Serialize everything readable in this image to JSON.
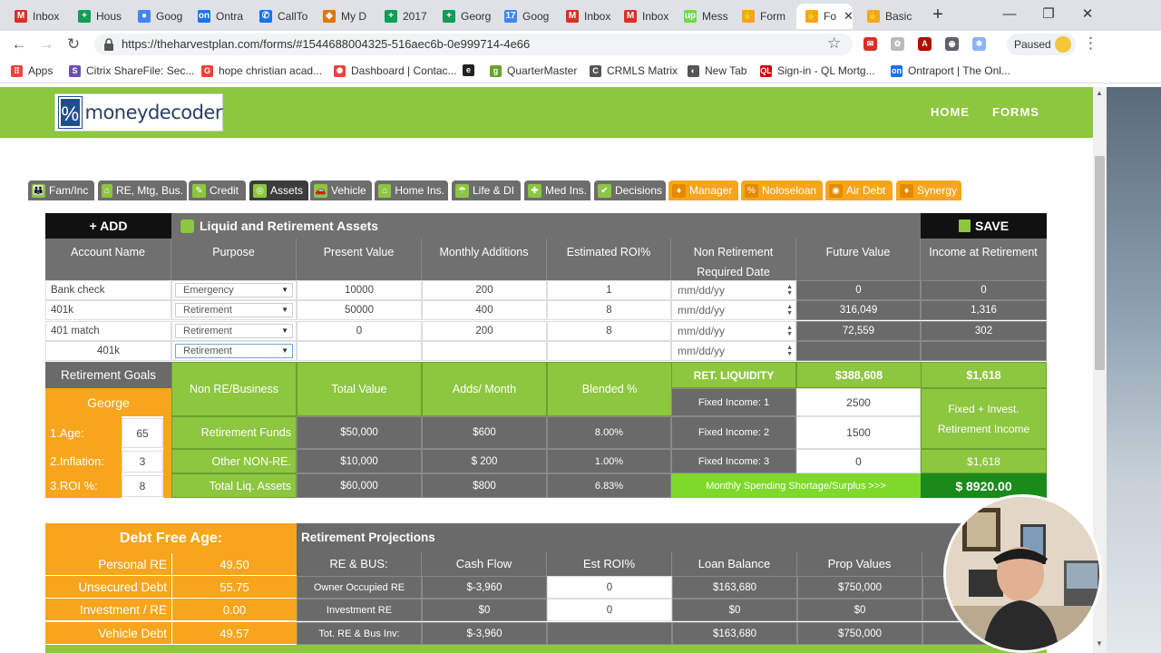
{
  "browser": {
    "tabs": [
      {
        "label": "Inbox",
        "icon": "gmail-icon",
        "color": "#d93025",
        "glyph": "M"
      },
      {
        "label": "Hous",
        "icon": "sheets-icon",
        "color": "#0f9d58",
        "glyph": "+"
      },
      {
        "label": "Goog",
        "icon": "google-icon",
        "color": "#4285f4",
        "glyph": "●"
      },
      {
        "label": "Ontra",
        "icon": "ontraport-icon",
        "color": "#1a73e8",
        "glyph": "on"
      },
      {
        "label": "CallTo",
        "icon": "phone-icon",
        "color": "#1a73e8",
        "glyph": "✆"
      },
      {
        "label": "My D",
        "icon": "drive-icon",
        "color": "#e37400",
        "glyph": "◆"
      },
      {
        "label": "2017",
        "icon": "sheets-icon",
        "color": "#0f9d58",
        "glyph": "+"
      },
      {
        "label": "Georg",
        "icon": "sheets-icon",
        "color": "#0f9d58",
        "glyph": "+"
      },
      {
        "label": "Goog",
        "icon": "calendar-icon",
        "color": "#4285f4",
        "glyph": "17"
      },
      {
        "label": "Inbox",
        "icon": "gmail-icon",
        "color": "#d93025",
        "glyph": "M"
      },
      {
        "label": "Inbox",
        "icon": "gmail-icon",
        "color": "#d93025",
        "glyph": "M"
      },
      {
        "label": "Mess",
        "icon": "upwork-icon",
        "color": "#6fda44",
        "glyph": "up"
      },
      {
        "label": "Form",
        "icon": "harvest-icon",
        "color": "#f7a51c",
        "glyph": "✋"
      },
      {
        "label": "Fo",
        "icon": "harvest-icon",
        "color": "#f7a51c",
        "glyph": "✋"
      },
      {
        "label": "Basic",
        "icon": "harvest-icon",
        "color": "#f7a51c",
        "glyph": "✋"
      }
    ],
    "url": "https://theharvestplan.com/forms/#1544688004325-516aec6b-0e999714-4e66",
    "paused_label": "Paused",
    "bookmarks": [
      {
        "label": "Apps",
        "icon": "apps-icon",
        "color": "#e8453c",
        "glyph": "⠿"
      },
      {
        "label": "Citrix ShareFile: Sec...",
        "icon": "citrix-icon",
        "color": "#6a4fb0",
        "glyph": "S"
      },
      {
        "label": "hope christian acad...",
        "icon": "google-icon",
        "color": "#ea4335",
        "glyph": "G"
      },
      {
        "label": "Dashboard | Contac...",
        "icon": "constant-contact-icon",
        "color": "#e8453c",
        "glyph": "✺"
      },
      {
        "label": "",
        "icon": "ebay-icon",
        "color": "#222",
        "glyph": "e"
      },
      {
        "label": "QuarterMaster",
        "icon": "quartermaster-icon",
        "color": "#6aa12d",
        "glyph": "g"
      },
      {
        "label": "CRMLS Matrix",
        "icon": "crmls-icon",
        "color": "#555",
        "glyph": "C"
      },
      {
        "label": "New Tab",
        "icon": "globe-icon",
        "color": "#555",
        "glyph": "◐"
      },
      {
        "label": "Sign-in - QL Mortg...",
        "icon": "ql-icon",
        "color": "#c00",
        "glyph": "QL"
      },
      {
        "label": "Ontraport | The Onl...",
        "icon": "ontraport-icon",
        "color": "#1a73e8",
        "glyph": "on"
      }
    ]
  },
  "site": {
    "logo_text": "moneydecoder",
    "nav": [
      "HOME",
      "FORMS"
    ]
  },
  "section_tabs": [
    {
      "label": "Fam/Inc",
      "style": "grey",
      "icon": "family-icon"
    },
    {
      "label": "RE, Mtg, Bus.",
      "style": "grey",
      "icon": "house-icon"
    },
    {
      "label": "Credit",
      "style": "grey",
      "icon": "credit-icon"
    },
    {
      "label": "Assets",
      "style": "dark",
      "icon": "assets-icon"
    },
    {
      "label": "Vehicle",
      "style": "grey",
      "icon": "car-icon"
    },
    {
      "label": "Home Ins.",
      "style": "grey",
      "icon": "home-ins-icon"
    },
    {
      "label": "Life & DI",
      "style": "grey",
      "icon": "umbrella-icon"
    },
    {
      "label": "Med Ins.",
      "style": "grey",
      "icon": "medical-icon"
    },
    {
      "label": "Decisions",
      "style": "grey",
      "icon": "decisions-icon"
    },
    {
      "label": "Manager",
      "style": "orange",
      "icon": "manager-icon"
    },
    {
      "label": "Noloseloan",
      "style": "orange",
      "icon": "noloseloan-icon"
    },
    {
      "label": "Air Debt",
      "style": "orange",
      "icon": "airdebt-icon"
    },
    {
      "label": "Synergy",
      "style": "orange",
      "icon": "synergy-icon"
    }
  ],
  "assets": {
    "add_label": "+ ADD",
    "title": "Liquid and Retirement Assets",
    "save_label": "SAVE",
    "columns": [
      "Account Name",
      "Purpose",
      "Present Value",
      "Monthly Additions",
      "Estimated ROI%",
      "Non Retirement Required Date",
      "Future Value",
      "Income at Retirement"
    ],
    "rows": [
      {
        "name": "Bank check",
        "purpose": "Emergency",
        "present": "10000",
        "monthly": "200",
        "roi": "1",
        "date": "mm/dd/yy",
        "future": "0",
        "income": "0"
      },
      {
        "name": "401k",
        "purpose": "Retirement",
        "present": "50000",
        "monthly": "400",
        "roi": "8",
        "date": "mm/dd/yy",
        "future": "316,049",
        "income": "1,316"
      },
      {
        "name": "401 match",
        "purpose": "Retirement",
        "present": "0",
        "monthly": "200",
        "roi": "8",
        "date": "mm/dd/yy",
        "future": "72,559",
        "income": "302"
      },
      {
        "name": "401k",
        "purpose": "Retirement",
        "present": "",
        "monthly": "",
        "roi": "",
        "date": "mm/dd/yy",
        "future": "",
        "income": ""
      }
    ]
  },
  "goals": {
    "title": "Retirement Goals",
    "person": "George",
    "age_label": "1.Age:",
    "age": "65",
    "inflation_label": "2.Inflation:",
    "inflation": "3",
    "roi_label": "3.ROI %:",
    "roi": "8",
    "headers": [
      "Non RE/Business",
      "Total Value",
      "Adds/ Month",
      "Blended %"
    ],
    "rows": [
      {
        "label": "Retirement Funds",
        "total": "$50,000",
        "adds": "$600",
        "blended": "8.00%"
      },
      {
        "label": "Other NON-RE.",
        "total": "$10,000",
        "adds": "$ 200",
        "blended": "1.00%"
      },
      {
        "label": "Total Liq. Assets",
        "total": "$60,000",
        "adds": "$800",
        "blended": "6.83%"
      }
    ],
    "ret_liquidity_label": "RET. LIQUIDITY",
    "ret_liquidity": "$388,608",
    "ret_income_top": "$1,618",
    "fixed": [
      {
        "label": "Fixed Income: 1",
        "value": "2500"
      },
      {
        "label": "Fixed Income: 2",
        "value": "1500"
      },
      {
        "label": "Fixed Income: 3",
        "value": "0"
      }
    ],
    "fixed_invest_label": "Fixed + Invest. Retirement Income",
    "fixed_invest_value": "$1,618",
    "shortage_label": "Monthly Spending Shortage/Surplus >>>",
    "shortage_value": "$ 8920.00"
  },
  "debt": {
    "title": "Debt Free Age:",
    "rows": [
      {
        "label": "Personal RE",
        "value": "49.50"
      },
      {
        "label": "Unsecured Debt",
        "value": "55.75"
      },
      {
        "label": "Investment / RE",
        "value": "0.00"
      },
      {
        "label": "Vehicle Debt",
        "value": "49.57"
      }
    ]
  },
  "projections": {
    "title": "Retirement Projections",
    "headers": [
      "RE & BUS:",
      "Cash Flow",
      "Est ROI%",
      "Loan Balance",
      "Prop Values"
    ],
    "rows": [
      {
        "label": "Owner Occupied RE",
        "cash": "$-3,960",
        "roi": "0",
        "loan": "$163,680",
        "prop": "$750,000"
      },
      {
        "label": "Investment RE",
        "cash": "$0",
        "roi": "0",
        "loan": "$0",
        "prop": "$0"
      },
      {
        "label": "Tot. RE & Bus Inv:",
        "cash": "$-3,960",
        "roi": "",
        "loan": "$163,680",
        "prop": "$750,000"
      }
    ]
  }
}
